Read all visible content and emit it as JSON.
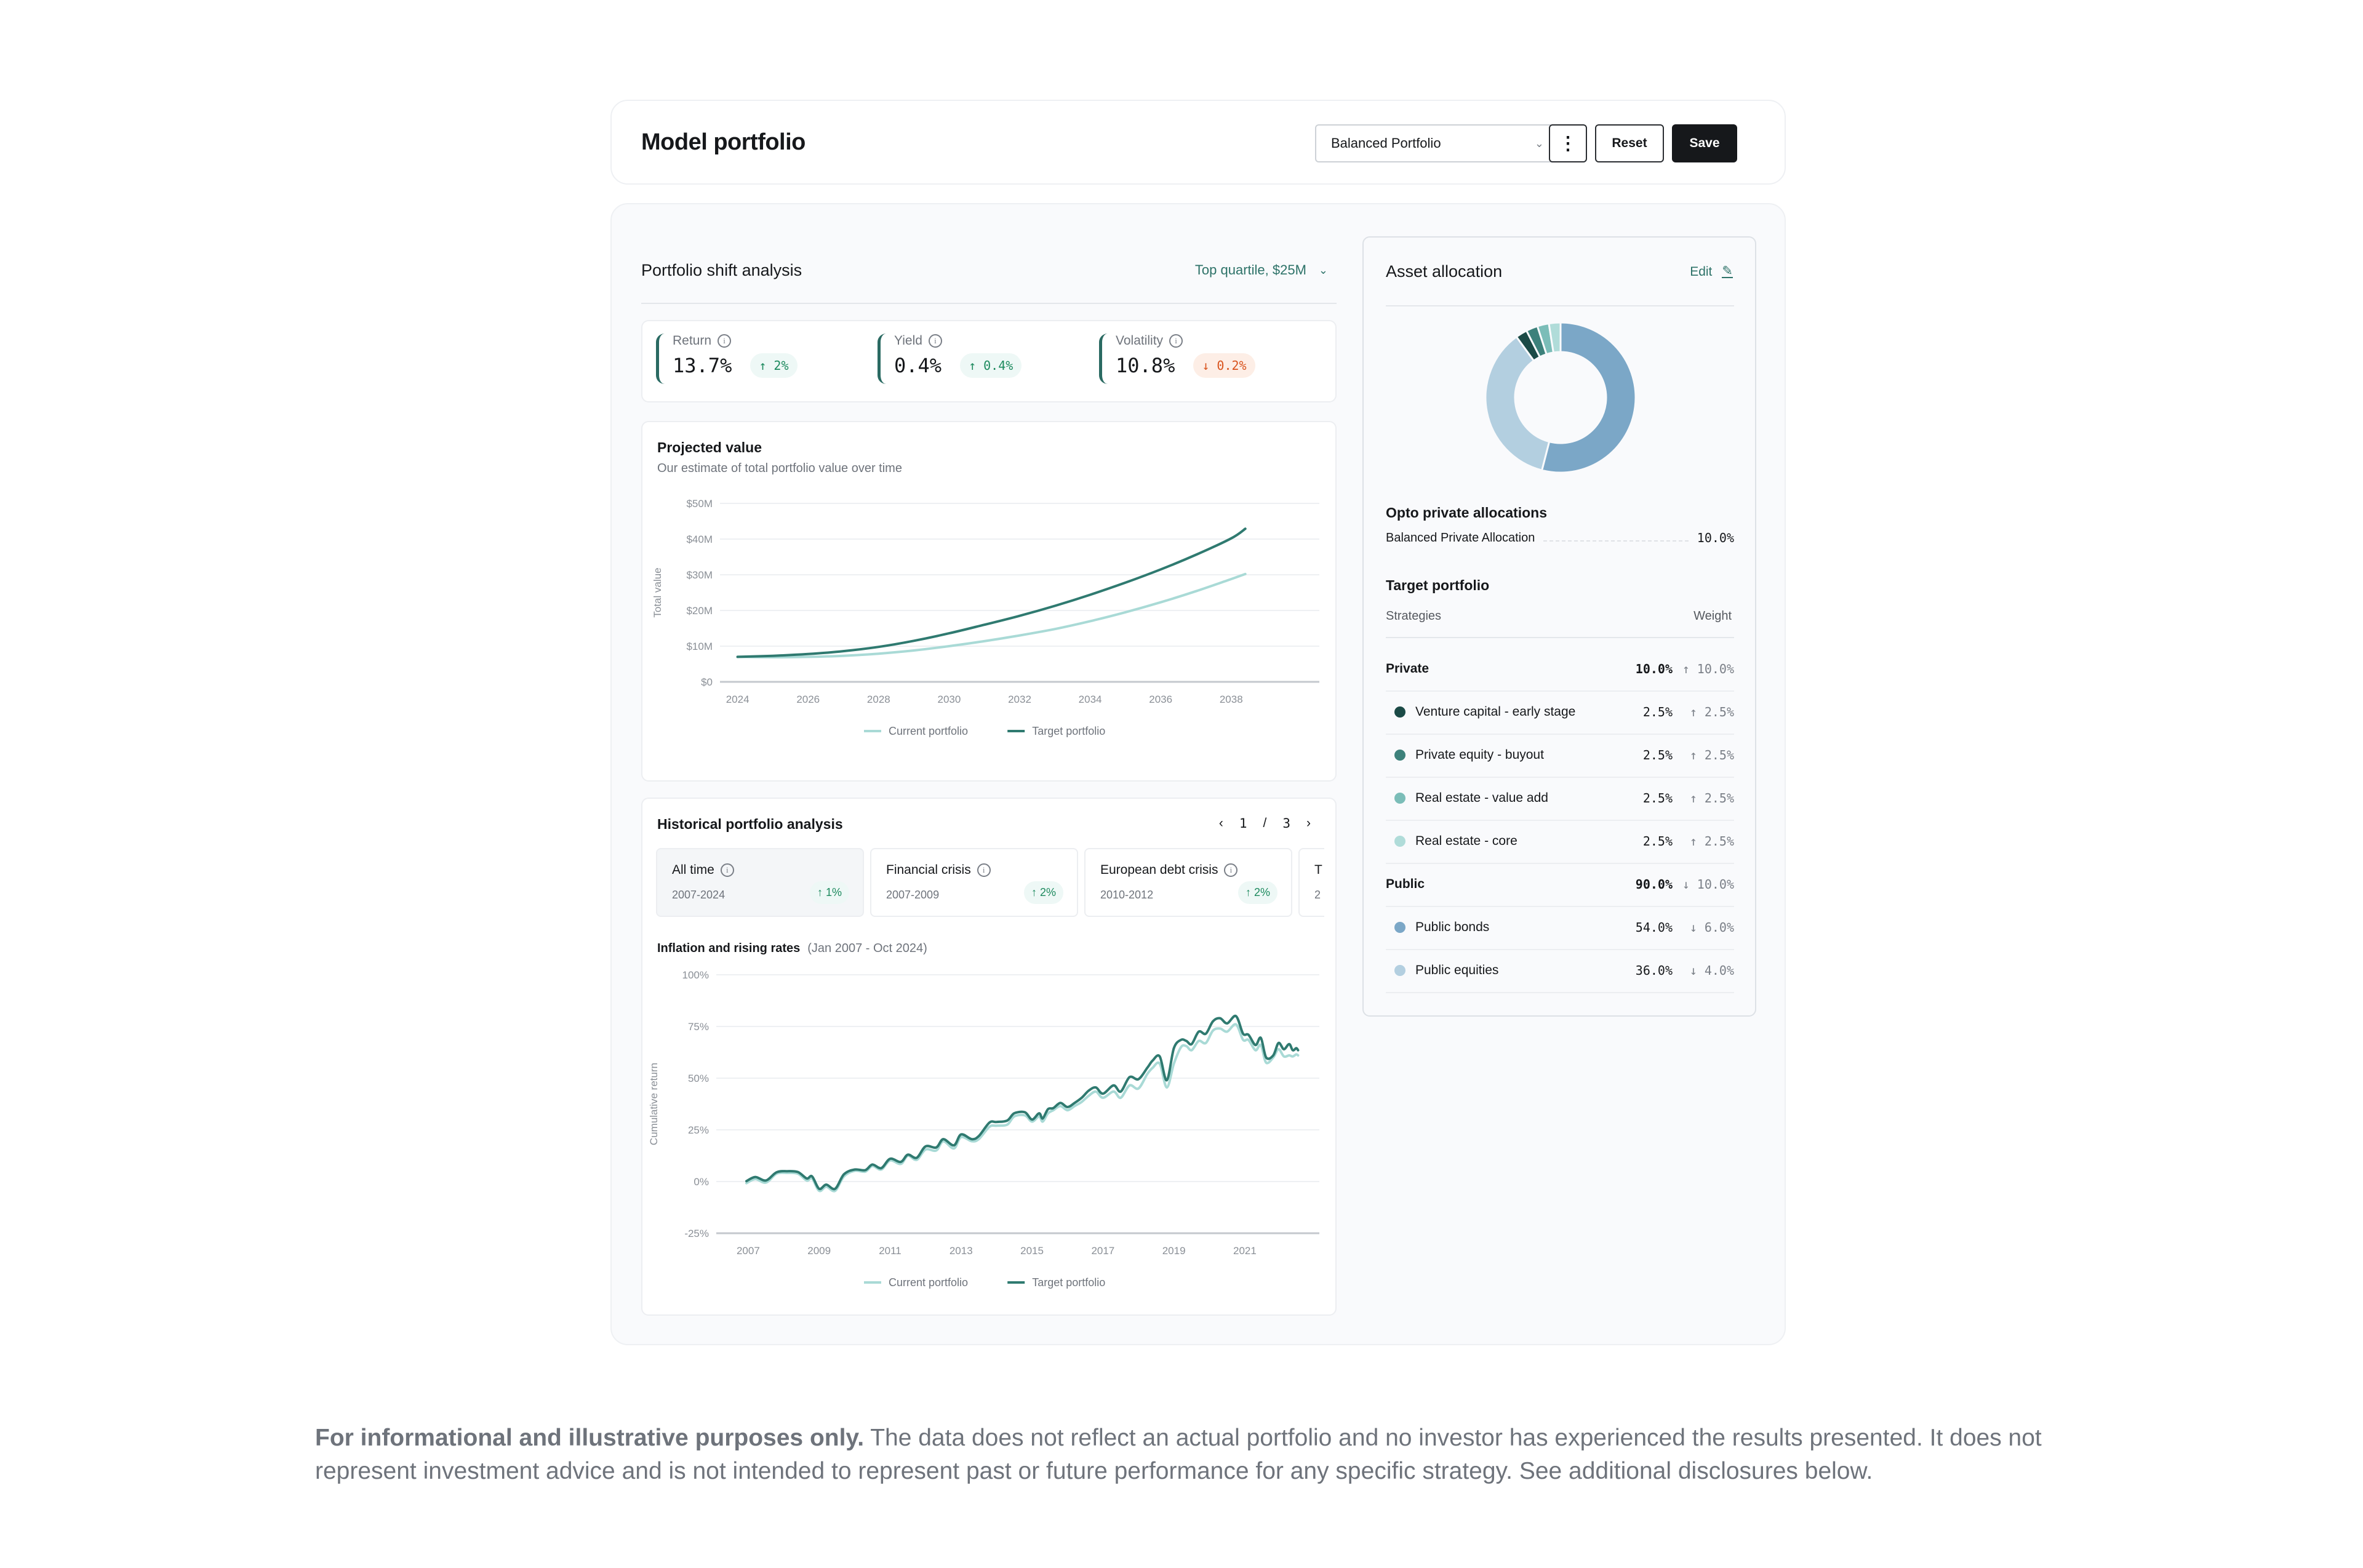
{
  "header": {
    "title": "Model portfolio",
    "portfolio_select": {
      "value": "Balanced Portfolio",
      "icon": "chevron-down-icon"
    },
    "more_icon": "kebab-icon",
    "reset_label": "Reset",
    "save_label": "Save"
  },
  "shift": {
    "title": "Portfolio shift analysis",
    "filter_label": "Top quartile, $25M",
    "metrics": [
      {
        "label": "Return",
        "value": "13.7%",
        "change": "↑ 2%",
        "direction": "up"
      },
      {
        "label": "Yield",
        "value": "0.4%",
        "change": "↑ 0.4%",
        "direction": "up"
      },
      {
        "label": "Volatility",
        "value": "10.8%",
        "change": "↓ 0.2%",
        "direction": "down"
      }
    ]
  },
  "projected": {
    "title": "Projected value",
    "subtitle": "Our estimate of total portfolio value over time"
  },
  "historical": {
    "title": "Historical portfolio analysis",
    "pager": {
      "current": "1",
      "separator": "/",
      "total": "3"
    },
    "scenarios": [
      {
        "name": "All time",
        "range": "2007-2024",
        "change": "↑ 1%"
      },
      {
        "name": "Financial crisis",
        "range": "2007-2009",
        "change": "↑ 2%"
      },
      {
        "name": "European debt crisis",
        "range": "2010-2012",
        "change": "↑ 2%"
      },
      {
        "name": "T",
        "range": "2",
        "change": ""
      }
    ],
    "chart_title": "Inflation and rising rates",
    "chart_range": "(Jan 2007 - Oct 2024)"
  },
  "allocation": {
    "title": "Asset allocation",
    "edit_label": "Edit",
    "opto_title": "Opto private allocations",
    "opto_item": {
      "name": "Balanced Private Allocation",
      "value": "10.0%"
    },
    "target_title": "Target portfolio",
    "col_strategies": "Strategies",
    "col_weight": "Weight",
    "rows": [
      {
        "type": "group",
        "name": "Private",
        "weight": "10.0%",
        "change": "↑ 10.0%"
      },
      {
        "type": "item",
        "name": "Venture capital - early stage",
        "weight": "2.5%",
        "change": "↑ 2.5%",
        "color": "#1b4a46"
      },
      {
        "type": "item",
        "name": "Private equity - buyout",
        "weight": "2.5%",
        "change": "↑ 2.5%",
        "color": "#3d817b"
      },
      {
        "type": "item",
        "name": "Real estate - value add",
        "weight": "2.5%",
        "change": "↑ 2.5%",
        "color": "#7bbdb8"
      },
      {
        "type": "item",
        "name": "Real estate - core",
        "weight": "2.5%",
        "change": "↑ 2.5%",
        "color": "#b0dcd9"
      },
      {
        "type": "group",
        "name": "Public",
        "weight": "90.0%",
        "change": "↓ 10.0%"
      },
      {
        "type": "item",
        "name": "Public bonds",
        "weight": "54.0%",
        "change": "↓ 6.0%",
        "color": "#7ba7c7"
      },
      {
        "type": "item",
        "name": "Public equities",
        "weight": "36.0%",
        "change": "↓ 4.0%",
        "color": "#b3cfe0"
      }
    ]
  },
  "disclaimer": {
    "bold": "For informational and illustrative purposes only.",
    "text": " The data does not reflect an actual portfolio and no investor has experienced the results presented. It does not represent investment advice and is not intended to represent past or future performance for any specific strategy. See additional disclosures below."
  },
  "colors": {
    "accent": "#2d7268",
    "target_line": "#2f7a70",
    "current_line": "#a9dad6",
    "up": "#1d8a5e",
    "down": "#d9541e"
  },
  "chart_data": [
    {
      "type": "line",
      "title": "Projected value",
      "xlabel": "",
      "ylabel": "Total value",
      "x_ticks": [
        "2024",
        "2026",
        "2028",
        "2030",
        "2032",
        "2034",
        "2036",
        "2038"
      ],
      "y_ticks": [
        "$0",
        "$10M",
        "$20M",
        "$30M",
        "$40M",
        "$50M"
      ],
      "xlim": [
        2023.5,
        2040.5
      ],
      "ylim": [
        0,
        50
      ],
      "x": [
        2024,
        2025,
        2026,
        2027,
        2028,
        2029,
        2030,
        2031,
        2032,
        2033,
        2034,
        2035,
        2036,
        2037,
        2038,
        2038.4
      ],
      "series": [
        {
          "name": "Current portfolio",
          "color": "#a9dad6",
          "values": [
            7.0,
            6.9,
            7.0,
            7.3,
            7.9,
            8.8,
            10.0,
            11.4,
            13.0,
            14.8,
            17.0,
            19.5,
            22.3,
            25.4,
            28.8,
            30.2
          ]
        },
        {
          "name": "Target portfolio",
          "color": "#2f7a70",
          "values": [
            7.0,
            7.3,
            7.8,
            8.6,
            9.8,
            11.5,
            13.6,
            16.0,
            18.5,
            21.3,
            24.4,
            27.8,
            31.5,
            35.6,
            40.2,
            42.9
          ]
        }
      ],
      "legend": "bottom",
      "grid": true
    },
    {
      "type": "line",
      "title": "Inflation and rising rates (Jan 2007 - Oct 2024)",
      "xlabel": "",
      "ylabel": "Cumulative return",
      "x_ticks": [
        "2007",
        "2009",
        "2011",
        "2013",
        "2015",
        "2017",
        "2019",
        "2021"
      ],
      "y_ticks": [
        "-25%",
        "0%",
        "25%",
        "50%",
        "75%",
        "100%"
      ],
      "xlim": [
        2006.1,
        2023.1
      ],
      "ylim": [
        -25,
        100
      ],
      "x": [
        2006.95,
        2007.2,
        2007.5,
        2007.8,
        2008.1,
        2008.4,
        2008.65,
        2008.8,
        2009.0,
        2009.2,
        2009.45,
        2009.7,
        2010.0,
        2010.3,
        2010.5,
        2010.75,
        2011.0,
        2011.3,
        2011.5,
        2011.75,
        2012.0,
        2012.3,
        2012.5,
        2012.8,
        2013.0,
        2013.3,
        2013.5,
        2013.8,
        2014.0,
        2014.3,
        2014.5,
        2014.8,
        2015.0,
        2015.2,
        2015.3,
        2015.45,
        2015.6,
        2015.8,
        2016.0,
        2016.2,
        2016.4,
        2016.6,
        2016.8,
        2017.0,
        2017.3,
        2017.5,
        2017.75,
        2018.0,
        2018.25,
        2018.4,
        2018.6,
        2018.8,
        2019.0,
        2019.2,
        2019.35,
        2019.5,
        2019.7,
        2019.9,
        2020.1,
        2020.3,
        2020.5,
        2020.75,
        2020.95,
        2021.1,
        2021.3,
        2021.45,
        2021.6,
        2021.8,
        2021.95,
        2022.1,
        2022.25,
        2022.35,
        2022.45,
        2022.5
      ],
      "series": [
        {
          "name": "Current portfolio",
          "color": "#a9dad6",
          "values": [
            -0.8,
            1.2,
            -0.5,
            3.8,
            4.2,
            3.8,
            0.5,
            1.5,
            -4.5,
            -2.5,
            -4.5,
            2.5,
            5.2,
            4.8,
            7.5,
            5.8,
            10.2,
            8.5,
            12.5,
            10.5,
            15.5,
            15.0,
            19.5,
            16.0,
            21.5,
            19.5,
            20.5,
            26.5,
            27.0,
            27.5,
            31.5,
            32.0,
            29.0,
            31.5,
            29.0,
            33.0,
            34.5,
            36.5,
            34.5,
            36.5,
            38.5,
            41.5,
            43.5,
            40.5,
            43.5,
            40.5,
            46.5,
            45.0,
            52.0,
            55.0,
            57.0,
            45.5,
            57.0,
            65.0,
            65.5,
            63.5,
            68.0,
            67.0,
            73.0,
            74.0,
            72.5,
            76.0,
            68.5,
            68.5,
            63.5,
            66.0,
            57.5,
            60.0,
            64.0,
            60.5,
            61.0,
            60.5,
            61.5,
            61.0
          ]
        },
        {
          "name": "Target portfolio",
          "color": "#2f7a70",
          "values": [
            0.2,
            2.2,
            0.5,
            4.5,
            5.0,
            4.6,
            1.5,
            2.5,
            -3.5,
            -1.5,
            -3.5,
            3.5,
            5.8,
            5.5,
            8.2,
            6.5,
            11.0,
            9.5,
            13.0,
            11.5,
            17.0,
            16.5,
            20.5,
            17.5,
            22.8,
            20.5,
            22.0,
            28.5,
            28.8,
            29.5,
            33.0,
            33.5,
            30.0,
            33.0,
            30.5,
            35.0,
            35.5,
            38.0,
            36.0,
            38.0,
            40.5,
            44.0,
            45.5,
            42.5,
            46.5,
            43.5,
            50.5,
            49.5,
            55.0,
            58.5,
            60.5,
            49.0,
            64.5,
            68.5,
            68.0,
            66.5,
            72.5,
            71.5,
            77.5,
            79.0,
            76.5,
            80.0,
            71.5,
            71.0,
            66.0,
            69.5,
            60.0,
            61.0,
            67.0,
            64.0,
            66.5,
            63.5,
            64.5,
            63.5
          ]
        }
      ],
      "legend": "bottom",
      "grid": true
    },
    {
      "type": "pie",
      "title": "Asset allocation",
      "categories": [
        "Public bonds",
        "Public equities",
        "Venture capital - early stage",
        "Private equity - buyout",
        "Real estate - value add",
        "Real estate - core"
      ],
      "values": [
        54.0,
        36.0,
        2.5,
        2.5,
        2.5,
        2.5
      ],
      "colors": [
        "#7ba7c7",
        "#b3cfe0",
        "#1b4a46",
        "#3d817b",
        "#7bbdb8",
        "#b0dcd9"
      ],
      "donut": true
    }
  ]
}
